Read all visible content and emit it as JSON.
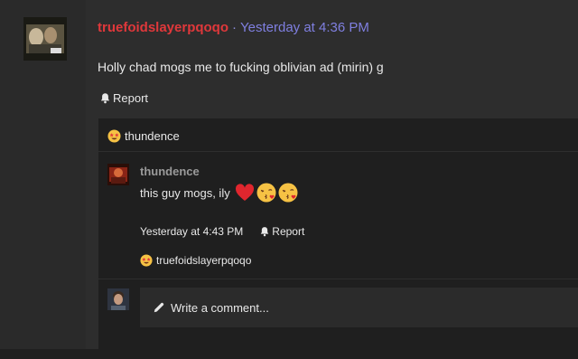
{
  "post": {
    "author": "truefoidslayerpqoqo",
    "separator": "·",
    "timestamp": "Yesterday at 4:36 PM",
    "body": "Holly chad mogs me to fucking oblivian ad (mirin) g",
    "report_label": "Report"
  },
  "reactions": {
    "user": "thundence",
    "emoji": "star-struck-icon"
  },
  "comment": {
    "author": "thundence",
    "text": "this guy mogs, ily",
    "emojis": [
      "heart-icon",
      "kissing-face-icon",
      "kissing-face-icon"
    ],
    "timestamp": "Yesterday at 4:43 PM",
    "report_label": "Report",
    "reaction_user": "truefoidslayerpqoqo",
    "reaction_emoji": "star-struck-icon"
  },
  "composer": {
    "placeholder": "Write a comment..."
  },
  "colors": {
    "author_red": "#e0383b",
    "timestamp_blue": "#7f7fe0"
  }
}
